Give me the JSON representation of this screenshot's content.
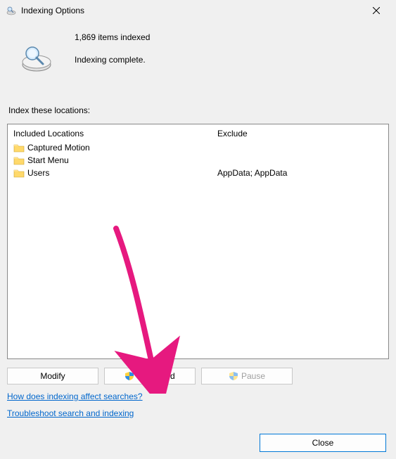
{
  "title": "Indexing Options",
  "status": {
    "count_text": "1,869 items indexed",
    "state_text": "Indexing complete."
  },
  "section_label": "Index these locations:",
  "columns": {
    "included": "Included Locations",
    "exclude": "Exclude"
  },
  "rows": [
    {
      "name": "Captured Motion",
      "exclude": ""
    },
    {
      "name": "Start Menu",
      "exclude": ""
    },
    {
      "name": "Users",
      "exclude": "AppData; AppData"
    }
  ],
  "buttons": {
    "modify": "Modify",
    "advanced": "Advanced",
    "pause": "Pause",
    "close": "Close"
  },
  "links": {
    "help": "How does indexing affect searches?",
    "troubleshoot": "Troubleshoot search and indexing"
  },
  "colors": {
    "link": "#0066cc",
    "highlight_border": "#0078d7",
    "arrow": "#e6197f"
  }
}
